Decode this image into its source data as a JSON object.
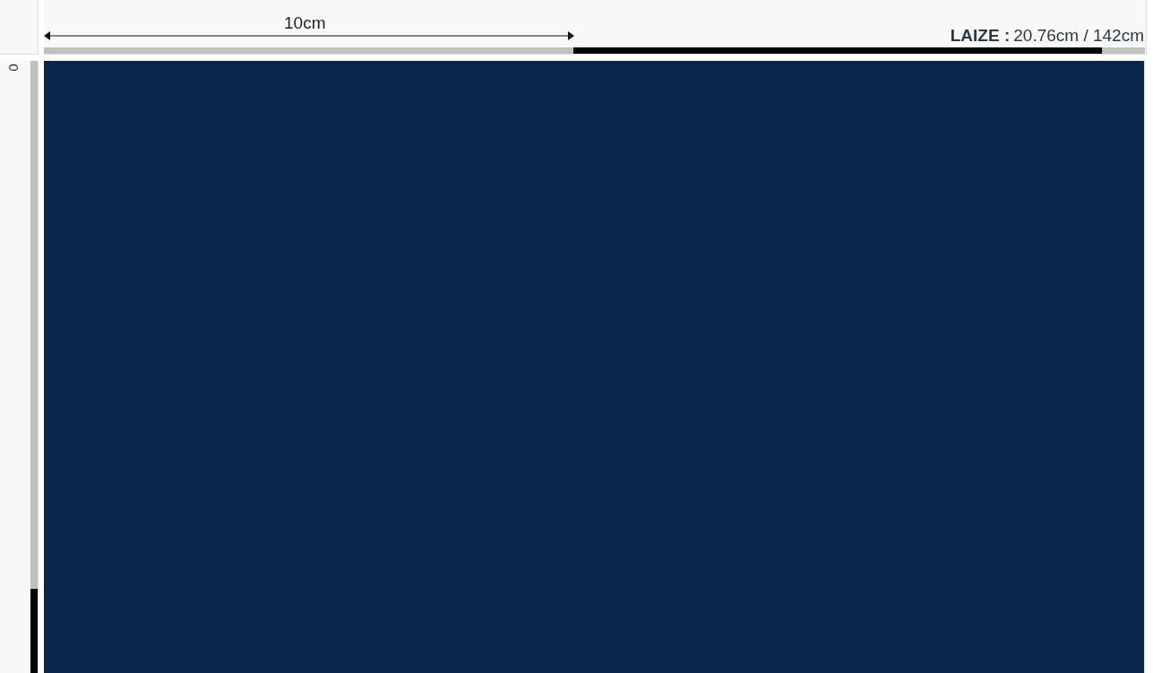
{
  "top_ruler": {
    "measure_label": "10cm",
    "laize": {
      "label": "LAIZE :",
      "value": "20.76cm / 142cm"
    }
  },
  "side_ruler": {
    "label": "0"
  },
  "preview": {
    "kind": "pattern"
  }
}
